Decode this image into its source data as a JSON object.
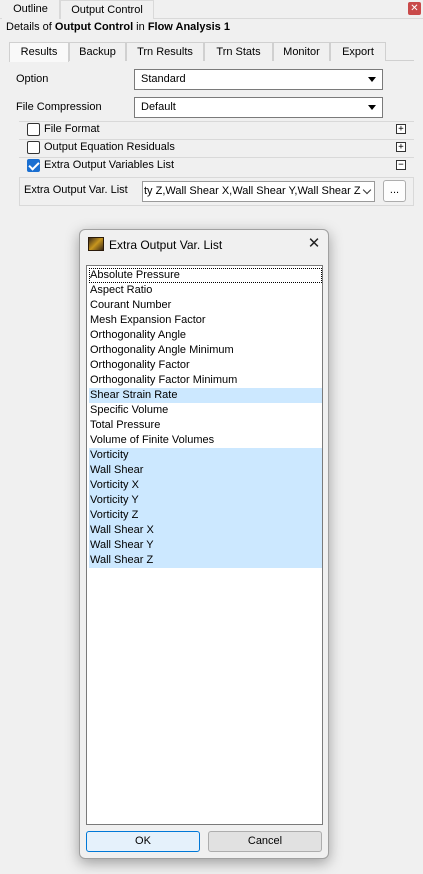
{
  "top_tabs": {
    "outline": "Outline",
    "output_control": "Output Control"
  },
  "details": {
    "prefix": "Details of ",
    "object": "Output Control",
    "middle": " in ",
    "analysis": "Flow Analysis 1"
  },
  "inner_tabs": [
    "Results",
    "Backup",
    "Trn Results",
    "Trn Stats",
    "Monitor",
    "Export"
  ],
  "results": {
    "option_label": "Option",
    "option_value": "Standard",
    "compression_label": "File Compression",
    "compression_value": "Default",
    "groups": [
      {
        "label": "File Format",
        "checked": false,
        "expander": "+"
      },
      {
        "label": "Output Equation Residuals",
        "checked": false,
        "expander": "+"
      },
      {
        "label": "Extra Output Variables List",
        "checked": true,
        "expander": "−"
      }
    ],
    "eov_label": "Extra Output Var. List",
    "eov_value": "ty Z,Wall Shear X,Wall Shear Y,Wall Shear Z",
    "eov_button": "..."
  },
  "dialog": {
    "title": "Extra Output Var. List",
    "items": [
      {
        "label": "Absolute Pressure",
        "selected": false,
        "focused": true
      },
      {
        "label": "Aspect Ratio",
        "selected": false
      },
      {
        "label": "Courant Number",
        "selected": false
      },
      {
        "label": "Mesh Expansion Factor",
        "selected": false
      },
      {
        "label": "Orthogonality Angle",
        "selected": false
      },
      {
        "label": "Orthogonality Angle Minimum",
        "selected": false
      },
      {
        "label": "Orthogonality Factor",
        "selected": false
      },
      {
        "label": "Orthogonality Factor Minimum",
        "selected": false
      },
      {
        "label": "Shear Strain Rate",
        "selected": true
      },
      {
        "label": "Specific Volume",
        "selected": false
      },
      {
        "label": "Total Pressure",
        "selected": false
      },
      {
        "label": "Volume of Finite Volumes",
        "selected": false
      },
      {
        "label": "Vorticity",
        "selected": true
      },
      {
        "label": "Wall Shear",
        "selected": true
      },
      {
        "label": "Vorticity X",
        "selected": true
      },
      {
        "label": "Vorticity Y",
        "selected": true
      },
      {
        "label": "Vorticity Z",
        "selected": true
      },
      {
        "label": "Wall Shear X",
        "selected": true
      },
      {
        "label": "Wall Shear Y",
        "selected": true
      },
      {
        "label": "Wall Shear Z",
        "selected": true
      }
    ],
    "ok_label": "OK",
    "cancel_label": "Cancel"
  },
  "colors": {
    "selection": "#cce8ff",
    "checkbox_accent": "#1a6fd1"
  }
}
